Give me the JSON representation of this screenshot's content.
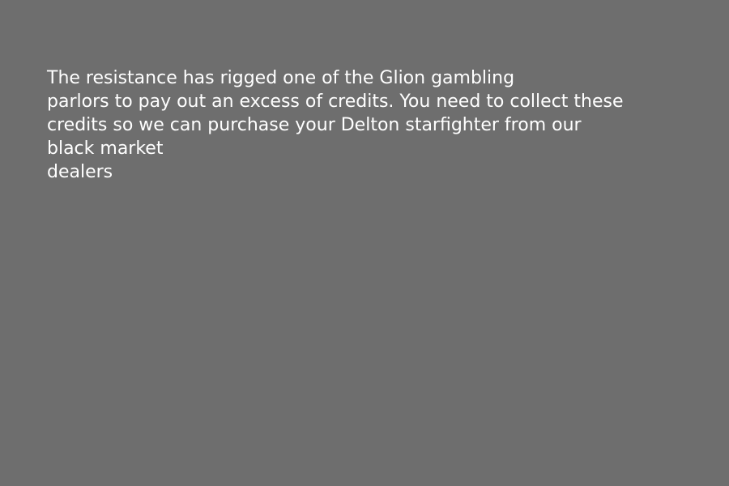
{
  "screen": {
    "background_color": "#6e6e6e",
    "text_color": "#ffffff"
  },
  "briefing": {
    "lines": [
      "The resistance has rigged one of the Glion gambling",
      "parlors to pay out an excess of credits. You need to collect these",
      "credits so we can purchase your Delton starfighter from our",
      "black market",
      "dealers"
    ]
  }
}
